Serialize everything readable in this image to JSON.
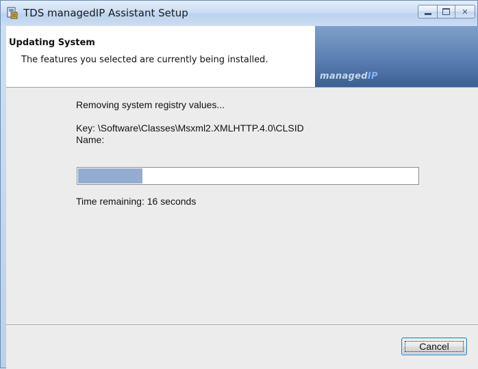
{
  "window": {
    "title": "TDS managedIP Assistant Setup",
    "icon": "installer-icon"
  },
  "title_controls": {
    "minimize": "minimize-icon",
    "maximize": "maximize-icon",
    "close_glyph": "✕"
  },
  "header": {
    "title": "Updating System",
    "subtitle": "The features you selected are currently being installed.",
    "logo_main": "managed",
    "logo_accent": "IP"
  },
  "progress": {
    "action": "Removing system registry values...",
    "key_line": "Key: \\Software\\Classes\\Msxml2.XMLHTTP.4.0\\CLSID",
    "name_line": "Name:",
    "fraction": 0.19,
    "time_remaining": "Time remaining: 16 seconds"
  },
  "footer": {
    "cancel_label": "Cancel"
  },
  "colors": {
    "progress_fill": "#94acd0",
    "banner": "#5b7fb2",
    "focus_border": "#3c7fb1"
  }
}
